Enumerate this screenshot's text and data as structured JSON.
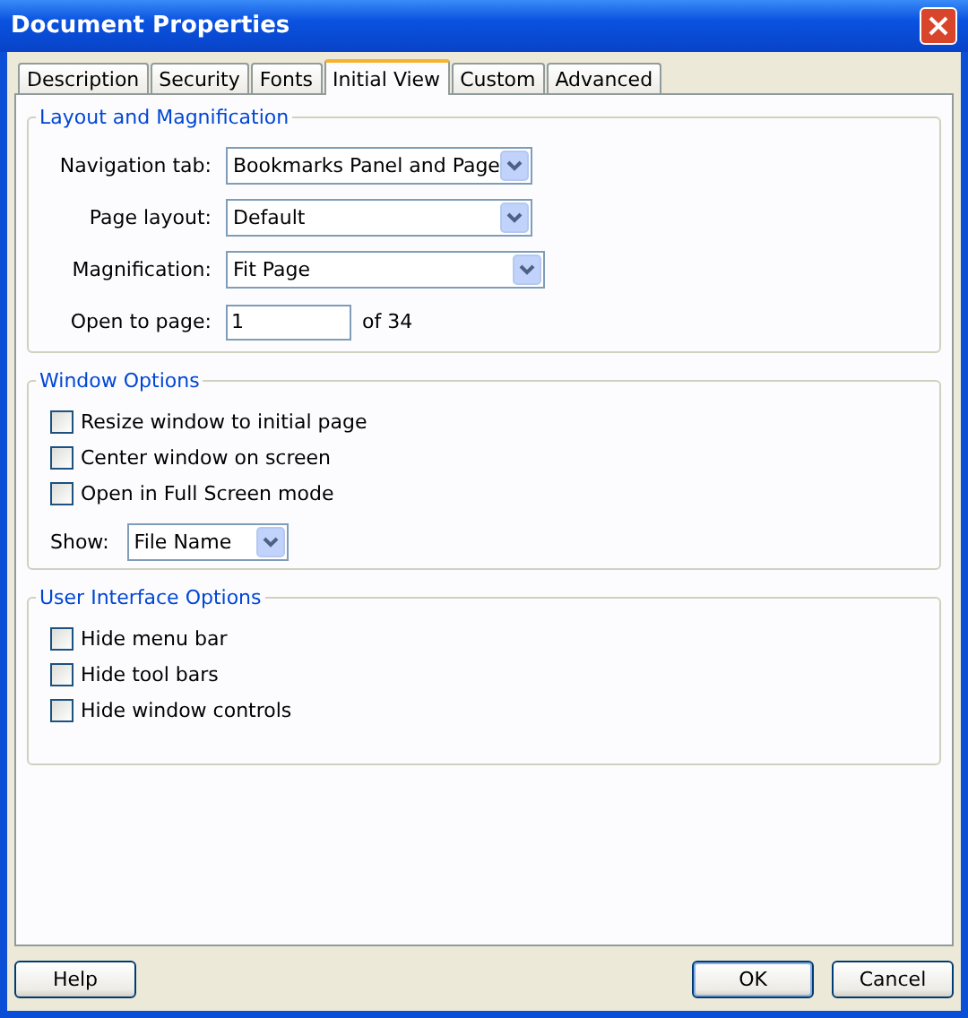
{
  "window": {
    "title": "Document Properties"
  },
  "tabs": [
    {
      "label": "Description",
      "selected": false
    },
    {
      "label": "Security",
      "selected": false
    },
    {
      "label": "Fonts",
      "selected": false
    },
    {
      "label": "Initial View",
      "selected": true
    },
    {
      "label": "Custom",
      "selected": false
    },
    {
      "label": "Advanced",
      "selected": false
    }
  ],
  "layout_group": {
    "title": "Layout and Magnification",
    "navigation_tab": {
      "label": "Navigation tab:",
      "value": "Bookmarks Panel and Page"
    },
    "page_layout": {
      "label": "Page layout:",
      "value": "Default"
    },
    "magnification": {
      "label": "Magnification:",
      "value": "Fit Page"
    },
    "open_to_page": {
      "label": "Open to page:",
      "value": "1",
      "suffix": "of 34"
    }
  },
  "window_options": {
    "title": "Window Options",
    "checkboxes": [
      {
        "label": "Resize window to initial page",
        "checked": false
      },
      {
        "label": "Center window on screen",
        "checked": false
      },
      {
        "label": "Open in Full Screen mode",
        "checked": false
      }
    ],
    "show": {
      "label": "Show:",
      "value": "File Name"
    }
  },
  "ui_options": {
    "title": "User Interface Options",
    "checkboxes": [
      {
        "label": "Hide menu bar",
        "checked": false
      },
      {
        "label": "Hide tool bars",
        "checked": false
      },
      {
        "label": "Hide window controls",
        "checked": false
      }
    ]
  },
  "buttons": {
    "help": "Help",
    "ok": "OK",
    "cancel": "Cancel"
  }
}
